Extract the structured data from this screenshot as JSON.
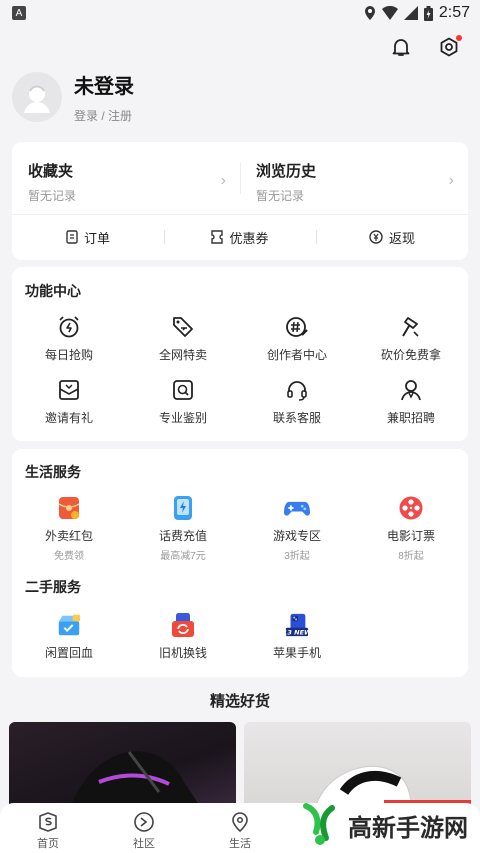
{
  "status_bar": {
    "time": "2:57"
  },
  "profile": {
    "name": "未登录",
    "sub": "登录 / 注册"
  },
  "records": [
    {
      "title": "收藏夹",
      "sub": "暂无记录"
    },
    {
      "title": "浏览历史",
      "sub": "暂无记录"
    }
  ],
  "quick_links": [
    "订单",
    "优惠券",
    "返现"
  ],
  "features": {
    "title": "功能中心",
    "items": [
      {
        "label": "每日抢购",
        "icon": "alarm-clock-icon"
      },
      {
        "label": "全网特卖",
        "icon": "price-tag-icon"
      },
      {
        "label": "创作者中心",
        "icon": "hashtag-pen-icon"
      },
      {
        "label": "砍价免费拿",
        "icon": "axe-icon"
      },
      {
        "label": "邀请有礼",
        "icon": "gift-envelope-icon"
      },
      {
        "label": "专业鉴别",
        "icon": "magnifier-icon"
      },
      {
        "label": "联系客服",
        "icon": "headset-icon"
      },
      {
        "label": "兼职招聘",
        "icon": "person-icon"
      }
    ]
  },
  "life": {
    "title": "生活服务",
    "items": [
      {
        "label": "外卖红包",
        "sub": "免费领",
        "icon": "red-envelope-icon",
        "color": "#f05a3a"
      },
      {
        "label": "话费充值",
        "sub": "最高减7元",
        "icon": "phone-bolt-icon",
        "color": "#3aa0f0"
      },
      {
        "label": "游戏专区",
        "sub": "3折起",
        "icon": "gamepad-icon",
        "color": "#3a7cf0"
      },
      {
        "label": "电影订票",
        "sub": "8折起",
        "icon": "film-reel-icon",
        "color": "#f04a4a"
      }
    ]
  },
  "secondhand": {
    "title": "二手服务",
    "items": [
      {
        "label": "闲置回血",
        "icon": "recycle-box-icon"
      },
      {
        "label": "旧机换钱",
        "icon": "phone-exchange-icon"
      },
      {
        "label": "苹果手机",
        "icon": "iphone-icon",
        "badge": "13 NEW"
      }
    ]
  },
  "picks": {
    "title": "精选好货"
  },
  "nav": [
    "首页",
    "社区",
    "生活"
  ],
  "watermark": "高新手游网",
  "colors": {
    "accent_red": "#f33333",
    "bg": "#f4f4f6"
  }
}
